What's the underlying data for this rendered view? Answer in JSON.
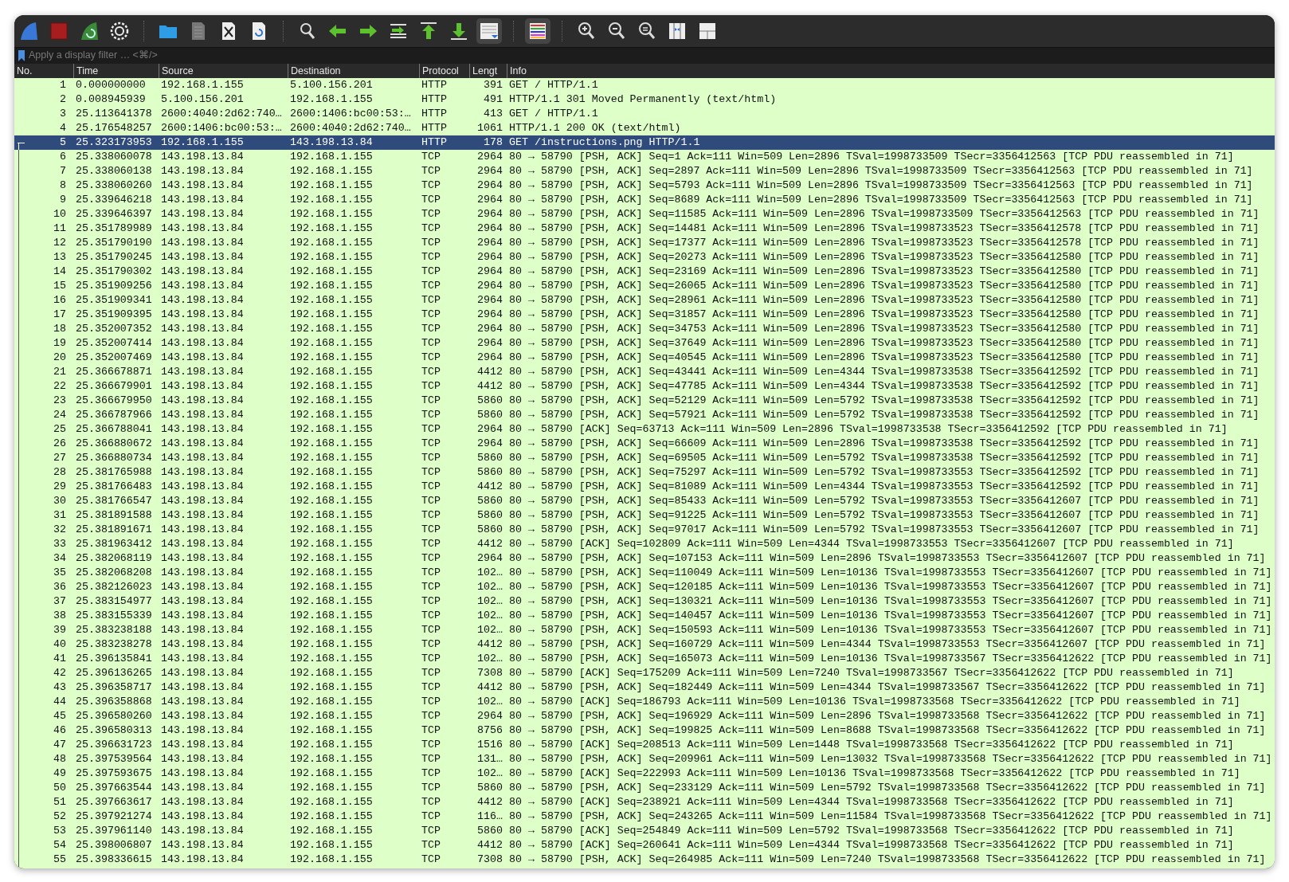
{
  "toolbar": [
    [
      {
        "on": false
      },
      {
        "on": false
      },
      {
        "on": false
      },
      {
        "on": false
      }
    ],
    [
      {
        "on": false
      },
      {
        "on": false
      },
      {
        "on": false
      },
      {
        "on": false
      }
    ],
    [
      {
        "on": false
      },
      {
        "on": false
      },
      {
        "on": false
      },
      {
        "on": false
      },
      {
        "on": false
      },
      {
        "on": false
      },
      {
        "on": true
      }
    ],
    [
      {
        "on": true
      }
    ],
    [
      {
        "on": false
      },
      {
        "on": false
      },
      {
        "on": false
      },
      {
        "on": false
      },
      {
        "on": false
      }
    ]
  ],
  "filter": {
    "placeholder": "Apply a display filter … <⌘/>"
  },
  "table": {
    "columns": [
      "No.",
      "Time",
      "Source",
      "Destination",
      "Protocol",
      "Lengt",
      "Info"
    ],
    "rows": [
      {
        "no": "1",
        "time": "0.000000000",
        "source": "192.168.1.155",
        "destination": "5.100.156.201",
        "protocol": "HTTP",
        "length": "391",
        "info": "GET / HTTP/1.1",
        "selected": false,
        "related": false
      },
      {
        "no": "2",
        "time": "0.008945939",
        "source": "5.100.156.201",
        "destination": "192.168.1.155",
        "protocol": "HTTP",
        "length": "491",
        "info": "HTTP/1.1 301 Moved Permanently  (text/html)",
        "selected": false,
        "related": false
      },
      {
        "no": "3",
        "time": "25.113641378",
        "source": "2600:4040:2d62:740…",
        "destination": "2600:1406:bc00:53:…",
        "protocol": "HTTP",
        "length": "413",
        "info": "GET / HTTP/1.1",
        "selected": false,
        "related": false
      },
      {
        "no": "4",
        "time": "25.176548257",
        "source": "2600:1406:bc00:53:…",
        "destination": "2600:4040:2d62:740…",
        "protocol": "HTTP",
        "length": "1061",
        "info": "HTTP/1.1 200 OK  (text/html)",
        "selected": false,
        "related": false
      },
      {
        "no": "5",
        "time": "25.323173953",
        "source": "192.168.1.155",
        "destination": "143.198.13.84",
        "protocol": "HTTP",
        "length": "178",
        "info": "GET /instructions.png HTTP/1.1",
        "selected": true,
        "related": true
      },
      {
        "no": "6",
        "time": "25.338060078",
        "source": "143.198.13.84",
        "destination": "192.168.1.155",
        "protocol": "TCP",
        "length": "2964",
        "info": "80 → 58790 [PSH, ACK] Seq=1 Ack=111 Win=509 Len=2896 TSval=1998733509 TSecr=3356412563 [TCP PDU reassembled in 71]",
        "selected": false,
        "related": true
      },
      {
        "no": "7",
        "time": "25.338060138",
        "source": "143.198.13.84",
        "destination": "192.168.1.155",
        "protocol": "TCP",
        "length": "2964",
        "info": "80 → 58790 [PSH, ACK] Seq=2897 Ack=111 Win=509 Len=2896 TSval=1998733509 TSecr=3356412563 [TCP PDU reassembled in 71]",
        "selected": false,
        "related": true
      },
      {
        "no": "8",
        "time": "25.338060260",
        "source": "143.198.13.84",
        "destination": "192.168.1.155",
        "protocol": "TCP",
        "length": "2964",
        "info": "80 → 58790 [PSH, ACK] Seq=5793 Ack=111 Win=509 Len=2896 TSval=1998733509 TSecr=3356412563 [TCP PDU reassembled in 71]",
        "selected": false,
        "related": true
      },
      {
        "no": "9",
        "time": "25.339646218",
        "source": "143.198.13.84",
        "destination": "192.168.1.155",
        "protocol": "TCP",
        "length": "2964",
        "info": "80 → 58790 [PSH, ACK] Seq=8689 Ack=111 Win=509 Len=2896 TSval=1998733509 TSecr=3356412563 [TCP PDU reassembled in 71]",
        "selected": false,
        "related": true
      },
      {
        "no": "10",
        "time": "25.339646397",
        "source": "143.198.13.84",
        "destination": "192.168.1.155",
        "protocol": "TCP",
        "length": "2964",
        "info": "80 → 58790 [PSH, ACK] Seq=11585 Ack=111 Win=509 Len=2896 TSval=1998733509 TSecr=3356412563 [TCP PDU reassembled in 71]",
        "selected": false,
        "related": true
      },
      {
        "no": "11",
        "time": "25.351789989",
        "source": "143.198.13.84",
        "destination": "192.168.1.155",
        "protocol": "TCP",
        "length": "2964",
        "info": "80 → 58790 [PSH, ACK] Seq=14481 Ack=111 Win=509 Len=2896 TSval=1998733523 TSecr=3356412578 [TCP PDU reassembled in 71]",
        "selected": false,
        "related": true
      },
      {
        "no": "12",
        "time": "25.351790190",
        "source": "143.198.13.84",
        "destination": "192.168.1.155",
        "protocol": "TCP",
        "length": "2964",
        "info": "80 → 58790 [PSH, ACK] Seq=17377 Ack=111 Win=509 Len=2896 TSval=1998733523 TSecr=3356412578 [TCP PDU reassembled in 71]",
        "selected": false,
        "related": true
      },
      {
        "no": "13",
        "time": "25.351790245",
        "source": "143.198.13.84",
        "destination": "192.168.1.155",
        "protocol": "TCP",
        "length": "2964",
        "info": "80 → 58790 [PSH, ACK] Seq=20273 Ack=111 Win=509 Len=2896 TSval=1998733523 TSecr=3356412580 [TCP PDU reassembled in 71]",
        "selected": false,
        "related": true
      },
      {
        "no": "14",
        "time": "25.351790302",
        "source": "143.198.13.84",
        "destination": "192.168.1.155",
        "protocol": "TCP",
        "length": "2964",
        "info": "80 → 58790 [PSH, ACK] Seq=23169 Ack=111 Win=509 Len=2896 TSval=1998733523 TSecr=3356412580 [TCP PDU reassembled in 71]",
        "selected": false,
        "related": true
      },
      {
        "no": "15",
        "time": "25.351909256",
        "source": "143.198.13.84",
        "destination": "192.168.1.155",
        "protocol": "TCP",
        "length": "2964",
        "info": "80 → 58790 [PSH, ACK] Seq=26065 Ack=111 Win=509 Len=2896 TSval=1998733523 TSecr=3356412580 [TCP PDU reassembled in 71]",
        "selected": false,
        "related": true
      },
      {
        "no": "16",
        "time": "25.351909341",
        "source": "143.198.13.84",
        "destination": "192.168.1.155",
        "protocol": "TCP",
        "length": "2964",
        "info": "80 → 58790 [PSH, ACK] Seq=28961 Ack=111 Win=509 Len=2896 TSval=1998733523 TSecr=3356412580 [TCP PDU reassembled in 71]",
        "selected": false,
        "related": true
      },
      {
        "no": "17",
        "time": "25.351909395",
        "source": "143.198.13.84",
        "destination": "192.168.1.155",
        "protocol": "TCP",
        "length": "2964",
        "info": "80 → 58790 [PSH, ACK] Seq=31857 Ack=111 Win=509 Len=2896 TSval=1998733523 TSecr=3356412580 [TCP PDU reassembled in 71]",
        "selected": false,
        "related": true
      },
      {
        "no": "18",
        "time": "25.352007352",
        "source": "143.198.13.84",
        "destination": "192.168.1.155",
        "protocol": "TCP",
        "length": "2964",
        "info": "80 → 58790 [PSH, ACK] Seq=34753 Ack=111 Win=509 Len=2896 TSval=1998733523 TSecr=3356412580 [TCP PDU reassembled in 71]",
        "selected": false,
        "related": true
      },
      {
        "no": "19",
        "time": "25.352007414",
        "source": "143.198.13.84",
        "destination": "192.168.1.155",
        "protocol": "TCP",
        "length": "2964",
        "info": "80 → 58790 [PSH, ACK] Seq=37649 Ack=111 Win=509 Len=2896 TSval=1998733523 TSecr=3356412580 [TCP PDU reassembled in 71]",
        "selected": false,
        "related": true
      },
      {
        "no": "20",
        "time": "25.352007469",
        "source": "143.198.13.84",
        "destination": "192.168.1.155",
        "protocol": "TCP",
        "length": "2964",
        "info": "80 → 58790 [PSH, ACK] Seq=40545 Ack=111 Win=509 Len=2896 TSval=1998733523 TSecr=3356412580 [TCP PDU reassembled in 71]",
        "selected": false,
        "related": true
      },
      {
        "no": "21",
        "time": "25.366678871",
        "source": "143.198.13.84",
        "destination": "192.168.1.155",
        "protocol": "TCP",
        "length": "4412",
        "info": "80 → 58790 [PSH, ACK] Seq=43441 Ack=111 Win=509 Len=4344 TSval=1998733538 TSecr=3356412592 [TCP PDU reassembled in 71]",
        "selected": false,
        "related": true
      },
      {
        "no": "22",
        "time": "25.366679901",
        "source": "143.198.13.84",
        "destination": "192.168.1.155",
        "protocol": "TCP",
        "length": "4412",
        "info": "80 → 58790 [PSH, ACK] Seq=47785 Ack=111 Win=509 Len=4344 TSval=1998733538 TSecr=3356412592 [TCP PDU reassembled in 71]",
        "selected": false,
        "related": true
      },
      {
        "no": "23",
        "time": "25.366679950",
        "source": "143.198.13.84",
        "destination": "192.168.1.155",
        "protocol": "TCP",
        "length": "5860",
        "info": "80 → 58790 [PSH, ACK] Seq=52129 Ack=111 Win=509 Len=5792 TSval=1998733538 TSecr=3356412592 [TCP PDU reassembled in 71]",
        "selected": false,
        "related": true
      },
      {
        "no": "24",
        "time": "25.366787966",
        "source": "143.198.13.84",
        "destination": "192.168.1.155",
        "protocol": "TCP",
        "length": "5860",
        "info": "80 → 58790 [PSH, ACK] Seq=57921 Ack=111 Win=509 Len=5792 TSval=1998733538 TSecr=3356412592 [TCP PDU reassembled in 71]",
        "selected": false,
        "related": true
      },
      {
        "no": "25",
        "time": "25.366788041",
        "source": "143.198.13.84",
        "destination": "192.168.1.155",
        "protocol": "TCP",
        "length": "2964",
        "info": "80 → 58790 [ACK] Seq=63713 Ack=111 Win=509 Len=2896 TSval=1998733538 TSecr=3356412592 [TCP PDU reassembled in 71]",
        "selected": false,
        "related": true
      },
      {
        "no": "26",
        "time": "25.366880672",
        "source": "143.198.13.84",
        "destination": "192.168.1.155",
        "protocol": "TCP",
        "length": "2964",
        "info": "80 → 58790 [PSH, ACK] Seq=66609 Ack=111 Win=509 Len=2896 TSval=1998733538 TSecr=3356412592 [TCP PDU reassembled in 71]",
        "selected": false,
        "related": true
      },
      {
        "no": "27",
        "time": "25.366880734",
        "source": "143.198.13.84",
        "destination": "192.168.1.155",
        "protocol": "TCP",
        "length": "5860",
        "info": "80 → 58790 [PSH, ACK] Seq=69505 Ack=111 Win=509 Len=5792 TSval=1998733538 TSecr=3356412592 [TCP PDU reassembled in 71]",
        "selected": false,
        "related": true
      },
      {
        "no": "28",
        "time": "25.381765988",
        "source": "143.198.13.84",
        "destination": "192.168.1.155",
        "protocol": "TCP",
        "length": "5860",
        "info": "80 → 58790 [PSH, ACK] Seq=75297 Ack=111 Win=509 Len=5792 TSval=1998733553 TSecr=3356412592 [TCP PDU reassembled in 71]",
        "selected": false,
        "related": true
      },
      {
        "no": "29",
        "time": "25.381766483",
        "source": "143.198.13.84",
        "destination": "192.168.1.155",
        "protocol": "TCP",
        "length": "4412",
        "info": "80 → 58790 [PSH, ACK] Seq=81089 Ack=111 Win=509 Len=4344 TSval=1998733553 TSecr=3356412592 [TCP PDU reassembled in 71]",
        "selected": false,
        "related": true
      },
      {
        "no": "30",
        "time": "25.381766547",
        "source": "143.198.13.84",
        "destination": "192.168.1.155",
        "protocol": "TCP",
        "length": "5860",
        "info": "80 → 58790 [PSH, ACK] Seq=85433 Ack=111 Win=509 Len=5792 TSval=1998733553 TSecr=3356412607 [TCP PDU reassembled in 71]",
        "selected": false,
        "related": true
      },
      {
        "no": "31",
        "time": "25.381891588",
        "source": "143.198.13.84",
        "destination": "192.168.1.155",
        "protocol": "TCP",
        "length": "5860",
        "info": "80 → 58790 [PSH, ACK] Seq=91225 Ack=111 Win=509 Len=5792 TSval=1998733553 TSecr=3356412607 [TCP PDU reassembled in 71]",
        "selected": false,
        "related": true
      },
      {
        "no": "32",
        "time": "25.381891671",
        "source": "143.198.13.84",
        "destination": "192.168.1.155",
        "protocol": "TCP",
        "length": "5860",
        "info": "80 → 58790 [PSH, ACK] Seq=97017 Ack=111 Win=509 Len=5792 TSval=1998733553 TSecr=3356412607 [TCP PDU reassembled in 71]",
        "selected": false,
        "related": true
      },
      {
        "no": "33",
        "time": "25.381963412",
        "source": "143.198.13.84",
        "destination": "192.168.1.155",
        "protocol": "TCP",
        "length": "4412",
        "info": "80 → 58790 [ACK] Seq=102809 Ack=111 Win=509 Len=4344 TSval=1998733553 TSecr=3356412607 [TCP PDU reassembled in 71]",
        "selected": false,
        "related": true
      },
      {
        "no": "34",
        "time": "25.382068119",
        "source": "143.198.13.84",
        "destination": "192.168.1.155",
        "protocol": "TCP",
        "length": "2964",
        "info": "80 → 58790 [PSH, ACK] Seq=107153 Ack=111 Win=509 Len=2896 TSval=1998733553 TSecr=3356412607 [TCP PDU reassembled in 71]",
        "selected": false,
        "related": true
      },
      {
        "no": "35",
        "time": "25.382068208",
        "source": "143.198.13.84",
        "destination": "192.168.1.155",
        "protocol": "TCP",
        "length": "102…",
        "info": "80 → 58790 [PSH, ACK] Seq=110049 Ack=111 Win=509 Len=10136 TSval=1998733553 TSecr=3356412607 [TCP PDU reassembled in 71]",
        "selected": false,
        "related": true
      },
      {
        "no": "36",
        "time": "25.382126023",
        "source": "143.198.13.84",
        "destination": "192.168.1.155",
        "protocol": "TCP",
        "length": "102…",
        "info": "80 → 58790 [PSH, ACK] Seq=120185 Ack=111 Win=509 Len=10136 TSval=1998733553 TSecr=3356412607 [TCP PDU reassembled in 71]",
        "selected": false,
        "related": true
      },
      {
        "no": "37",
        "time": "25.383154977",
        "source": "143.198.13.84",
        "destination": "192.168.1.155",
        "protocol": "TCP",
        "length": "102…",
        "info": "80 → 58790 [PSH, ACK] Seq=130321 Ack=111 Win=509 Len=10136 TSval=1998733553 TSecr=3356412607 [TCP PDU reassembled in 71]",
        "selected": false,
        "related": true
      },
      {
        "no": "38",
        "time": "25.383155339",
        "source": "143.198.13.84",
        "destination": "192.168.1.155",
        "protocol": "TCP",
        "length": "102…",
        "info": "80 → 58790 [PSH, ACK] Seq=140457 Ack=111 Win=509 Len=10136 TSval=1998733553 TSecr=3356412607 [TCP PDU reassembled in 71]",
        "selected": false,
        "related": true
      },
      {
        "no": "39",
        "time": "25.383238188",
        "source": "143.198.13.84",
        "destination": "192.168.1.155",
        "protocol": "TCP",
        "length": "102…",
        "info": "80 → 58790 [PSH, ACK] Seq=150593 Ack=111 Win=509 Len=10136 TSval=1998733553 TSecr=3356412607 [TCP PDU reassembled in 71]",
        "selected": false,
        "related": true
      },
      {
        "no": "40",
        "time": "25.383238278",
        "source": "143.198.13.84",
        "destination": "192.168.1.155",
        "protocol": "TCP",
        "length": "4412",
        "info": "80 → 58790 [PSH, ACK] Seq=160729 Ack=111 Win=509 Len=4344 TSval=1998733553 TSecr=3356412607 [TCP PDU reassembled in 71]",
        "selected": false,
        "related": true
      },
      {
        "no": "41",
        "time": "25.396135841",
        "source": "143.198.13.84",
        "destination": "192.168.1.155",
        "protocol": "TCP",
        "length": "102…",
        "info": "80 → 58790 [PSH, ACK] Seq=165073 Ack=111 Win=509 Len=10136 TSval=1998733567 TSecr=3356412622 [TCP PDU reassembled in 71]",
        "selected": false,
        "related": true
      },
      {
        "no": "42",
        "time": "25.396136265",
        "source": "143.198.13.84",
        "destination": "192.168.1.155",
        "protocol": "TCP",
        "length": "7308",
        "info": "80 → 58790 [ACK] Seq=175209 Ack=111 Win=509 Len=7240 TSval=1998733567 TSecr=3356412622 [TCP PDU reassembled in 71]",
        "selected": false,
        "related": true
      },
      {
        "no": "43",
        "time": "25.396358717",
        "source": "143.198.13.84",
        "destination": "192.168.1.155",
        "protocol": "TCP",
        "length": "4412",
        "info": "80 → 58790 [PSH, ACK] Seq=182449 Ack=111 Win=509 Len=4344 TSval=1998733567 TSecr=3356412622 [TCP PDU reassembled in 71]",
        "selected": false,
        "related": true
      },
      {
        "no": "44",
        "time": "25.396358868",
        "source": "143.198.13.84",
        "destination": "192.168.1.155",
        "protocol": "TCP",
        "length": "102…",
        "info": "80 → 58790 [ACK] Seq=186793 Ack=111 Win=509 Len=10136 TSval=1998733568 TSecr=3356412622 [TCP PDU reassembled in 71]",
        "selected": false,
        "related": true
      },
      {
        "no": "45",
        "time": "25.396580260",
        "source": "143.198.13.84",
        "destination": "192.168.1.155",
        "protocol": "TCP",
        "length": "2964",
        "info": "80 → 58790 [PSH, ACK] Seq=196929 Ack=111 Win=509 Len=2896 TSval=1998733568 TSecr=3356412622 [TCP PDU reassembled in 71]",
        "selected": false,
        "related": true
      },
      {
        "no": "46",
        "time": "25.396580313",
        "source": "143.198.13.84",
        "destination": "192.168.1.155",
        "protocol": "TCP",
        "length": "8756",
        "info": "80 → 58790 [PSH, ACK] Seq=199825 Ack=111 Win=509 Len=8688 TSval=1998733568 TSecr=3356412622 [TCP PDU reassembled in 71]",
        "selected": false,
        "related": true
      },
      {
        "no": "47",
        "time": "25.396631723",
        "source": "143.198.13.84",
        "destination": "192.168.1.155",
        "protocol": "TCP",
        "length": "1516",
        "info": "80 → 58790 [ACK] Seq=208513 Ack=111 Win=509 Len=1448 TSval=1998733568 TSecr=3356412622 [TCP PDU reassembled in 71]",
        "selected": false,
        "related": true
      },
      {
        "no": "48",
        "time": "25.397539564",
        "source": "143.198.13.84",
        "destination": "192.168.1.155",
        "protocol": "TCP",
        "length": "131…",
        "info": "80 → 58790 [PSH, ACK] Seq=209961 Ack=111 Win=509 Len=13032 TSval=1998733568 TSecr=3356412622 [TCP PDU reassembled in 71]",
        "selected": false,
        "related": true
      },
      {
        "no": "49",
        "time": "25.397593675",
        "source": "143.198.13.84",
        "destination": "192.168.1.155",
        "protocol": "TCP",
        "length": "102…",
        "info": "80 → 58790 [ACK] Seq=222993 Ack=111 Win=509 Len=10136 TSval=1998733568 TSecr=3356412622 [TCP PDU reassembled in 71]",
        "selected": false,
        "related": true
      },
      {
        "no": "50",
        "time": "25.397663544",
        "source": "143.198.13.84",
        "destination": "192.168.1.155",
        "protocol": "TCP",
        "length": "5860",
        "info": "80 → 58790 [PSH, ACK] Seq=233129 Ack=111 Win=509 Len=5792 TSval=1998733568 TSecr=3356412622 [TCP PDU reassembled in 71]",
        "selected": false,
        "related": true
      },
      {
        "no": "51",
        "time": "25.397663617",
        "source": "143.198.13.84",
        "destination": "192.168.1.155",
        "protocol": "TCP",
        "length": "4412",
        "info": "80 → 58790 [ACK] Seq=238921 Ack=111 Win=509 Len=4344 TSval=1998733568 TSecr=3356412622 [TCP PDU reassembled in 71]",
        "selected": false,
        "related": true
      },
      {
        "no": "52",
        "time": "25.397921274",
        "source": "143.198.13.84",
        "destination": "192.168.1.155",
        "protocol": "TCP",
        "length": "116…",
        "info": "80 → 58790 [PSH, ACK] Seq=243265 Ack=111 Win=509 Len=11584 TSval=1998733568 TSecr=3356412622 [TCP PDU reassembled in 71]",
        "selected": false,
        "related": true
      },
      {
        "no": "53",
        "time": "25.397961140",
        "source": "143.198.13.84",
        "destination": "192.168.1.155",
        "protocol": "TCP",
        "length": "5860",
        "info": "80 → 58790 [ACK] Seq=254849 Ack=111 Win=509 Len=5792 TSval=1998733568 TSecr=3356412622 [TCP PDU reassembled in 71]",
        "selected": false,
        "related": true
      },
      {
        "no": "54",
        "time": "25.398006807",
        "source": "143.198.13.84",
        "destination": "192.168.1.155",
        "protocol": "TCP",
        "length": "4412",
        "info": "80 → 58790 [ACK] Seq=260641 Ack=111 Win=509 Len=4344 TSval=1998733568 TSecr=3356412622 [TCP PDU reassembled in 71]",
        "selected": false,
        "related": true
      },
      {
        "no": "55",
        "time": "25.398336615",
        "source": "143.198.13.84",
        "destination": "192.168.1.155",
        "protocol": "TCP",
        "length": "7308",
        "info": "80 → 58790 [PSH, ACK] Seq=264985 Ack=111 Win=509 Len=7240 TSval=1998733568 TSecr=3356412622 [TCP PDU reassembled in 71]",
        "selected": false,
        "related": true
      }
    ]
  }
}
